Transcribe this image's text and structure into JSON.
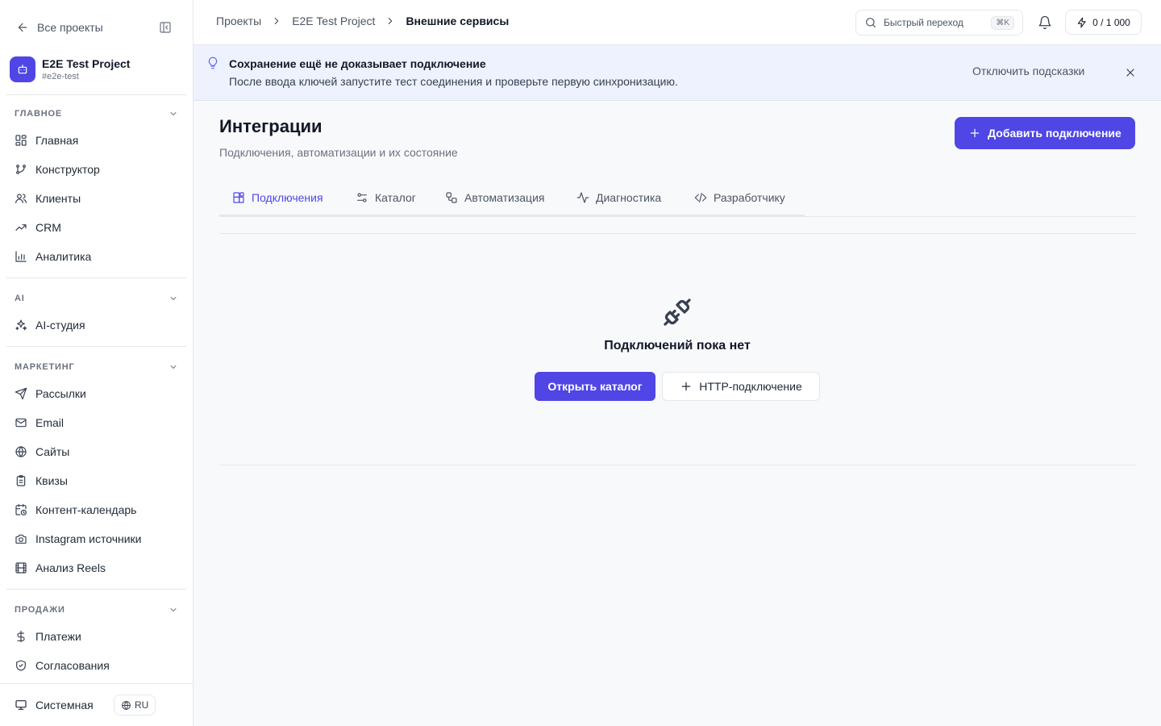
{
  "sidebar": {
    "back_label": "Все проекты",
    "project": {
      "name": "E2E Test Project",
      "slug": "#e2e-test"
    },
    "sections": {
      "main": {
        "title": "ГЛАВНОЕ",
        "items": [
          "Главная",
          "Конструктор",
          "Клиенты",
          "CRM",
          "Аналитика"
        ]
      },
      "ai": {
        "title": "AI",
        "items": [
          "AI-студия"
        ]
      },
      "marketing": {
        "title": "МАРКЕТИНГ",
        "items": [
          "Рассылки",
          "Email",
          "Сайты",
          "Квизы",
          "Контент-календарь",
          "Instagram источники",
          "Анализ Reels"
        ]
      },
      "sales": {
        "title": "ПРОДАЖИ",
        "items": [
          "Платежи",
          "Согласования"
        ]
      }
    },
    "theme_label": "Системная",
    "lang_label": "RU"
  },
  "topbar": {
    "breadcrumbs": [
      "Проекты",
      "E2E Test Project",
      "Внешние сервисы"
    ],
    "search_placeholder": "Быстрый переход",
    "search_shortcut": "⌘K",
    "credits": "0 / 1 000"
  },
  "hint": {
    "title": "Сохранение ещё не доказывает подключение",
    "text": "После ввода ключей запустите тест соединения и проверьте первую синхронизацию.",
    "disable_label": "Отключить подсказки"
  },
  "page": {
    "title": "Интеграции",
    "subtitle": "Подключения, автоматизации и их состояние",
    "add_button": "Добавить подключение",
    "tabs": [
      "Подключения",
      "Каталог",
      "Автоматизация",
      "Диагностика",
      "Разработчику"
    ],
    "active_tab": "Подключения",
    "empty": {
      "title": "Подключений пока нет",
      "open_catalog": "Открыть каталог",
      "http_connection": "HTTP-подключение"
    }
  },
  "colors": {
    "accent": "#4f46e5",
    "hint_bg": "#eef2ff"
  }
}
